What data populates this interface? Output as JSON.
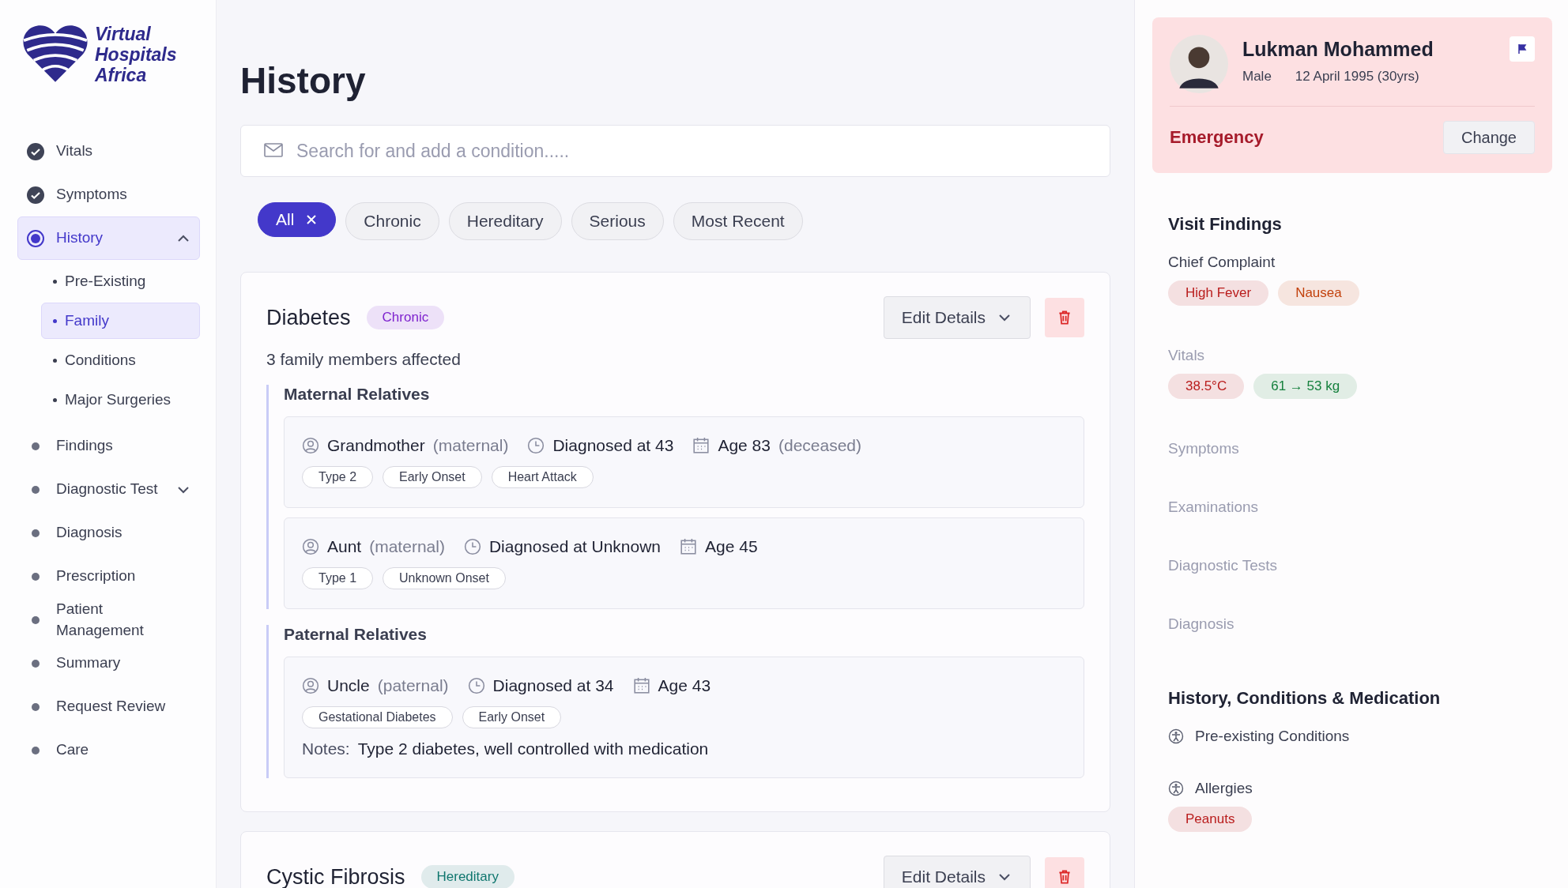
{
  "logo": {
    "lines": [
      "Virtual",
      "Hospitals",
      "Africa"
    ]
  },
  "sidebar": {
    "items": [
      {
        "label": "Vitals",
        "kind": "done",
        "selected": false
      },
      {
        "label": "Symptoms",
        "kind": "done",
        "selected": false
      },
      {
        "label": "History",
        "kind": "current",
        "selected": true,
        "expanded": true,
        "children": [
          {
            "label": "Pre-Existing",
            "selected": false
          },
          {
            "label": "Family",
            "selected": true
          },
          {
            "label": "Conditions",
            "selected": false
          },
          {
            "label": "Major Surgeries",
            "selected": false
          }
        ]
      },
      {
        "label": "Findings",
        "kind": "todo",
        "selected": false
      },
      {
        "label": "Diagnostic Test",
        "kind": "todo",
        "selected": false,
        "expanded": false
      },
      {
        "label": "Diagnosis",
        "kind": "todo",
        "selected": false
      },
      {
        "label": "Prescription",
        "kind": "todo",
        "selected": false
      },
      {
        "label": "Patient Management",
        "kind": "todo",
        "selected": false
      },
      {
        "label": "Summary",
        "kind": "todo",
        "selected": false
      },
      {
        "label": "Request Review",
        "kind": "todo",
        "selected": false
      },
      {
        "label": "Care",
        "kind": "todo",
        "selected": false
      }
    ]
  },
  "page": {
    "title": "History",
    "search": {
      "placeholder": "Search for and add a condition....."
    },
    "filters": [
      {
        "label": "All",
        "selected": true
      },
      {
        "label": "Chronic",
        "selected": false
      },
      {
        "label": "Hereditary",
        "selected": false
      },
      {
        "label": "Serious",
        "selected": false
      },
      {
        "label": "Most Recent",
        "selected": false
      }
    ],
    "conditions": [
      {
        "name": "Diabetes",
        "tag": {
          "label": "Chronic",
          "color": "#7e22ce"
        },
        "edit": "Edit Details",
        "summary": "3 family members affected",
        "groups": [
          {
            "title": "Maternal Relatives",
            "members": [
              {
                "relation": "Grandmother",
                "side": "(maternal)",
                "diagnosed": "Diagnosed at 43",
                "age": "Age 83",
                "status": "(deceased)",
                "tags": [
                  "Type 2",
                  "Early Onset",
                  "Heart Attack"
                ]
              },
              {
                "relation": "Aunt",
                "side": "(maternal)",
                "diagnosed": "Diagnosed at Unknown",
                "age": "Age 45",
                "tags": [
                  "Type 1",
                  "Unknown Onset"
                ]
              }
            ]
          },
          {
            "title": "Paternal Relatives",
            "members": [
              {
                "relation": "Uncle",
                "side": "(paternal)",
                "diagnosed": "Diagnosed at 34",
                "age": "Age 43",
                "tags": [
                  "Gestational Diabetes",
                  "Early Onset"
                ],
                "notes_label": "Notes:",
                "notes": "Type 2 diabetes, well controlled with medication"
              }
            ]
          }
        ]
      },
      {
        "name": "Cystic Fibrosis",
        "tag": {
          "label": "Hereditary",
          "color": "#0f766e"
        },
        "edit": "Edit Details"
      }
    ]
  },
  "patient": {
    "name": "Lukman Mohammed",
    "gender": "Male",
    "dob": "12 April 1995 (30yrs)",
    "priority": "Emergency",
    "change": "Change"
  },
  "findings": {
    "title": "Visit Findings",
    "sections": [
      {
        "label": "Chief Complaint",
        "muted": false,
        "chips": [
          {
            "label": "High Fever",
            "color": "#b91c1c"
          },
          {
            "label": "Nausea",
            "color": "#c2410c"
          }
        ]
      },
      {
        "label": "Vitals",
        "muted": true,
        "chips": [
          {
            "label": "38.5°C",
            "color": "#b91c1c"
          },
          {
            "label": "61 → 53 kg",
            "color": "#15803d"
          }
        ]
      },
      {
        "label": "Symptoms",
        "muted": true
      },
      {
        "label": "Examinations",
        "muted": true
      },
      {
        "label": "Diagnostic Tests",
        "muted": true
      },
      {
        "label": "Diagnosis",
        "muted": true
      }
    ]
  },
  "history": {
    "title": "History, Conditions & Medication",
    "items": [
      {
        "label": "Pre-existing Conditions"
      },
      {
        "label": "Allergies",
        "chips": [
          {
            "label": "Peanuts",
            "color": "#b91c1c"
          }
        ]
      }
    ]
  }
}
